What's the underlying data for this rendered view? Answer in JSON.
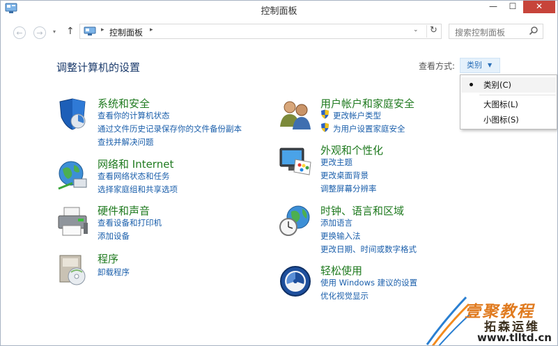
{
  "window": {
    "title": "控制面板",
    "minimize_glyph": "—",
    "maximize_glyph": "☐",
    "close_glyph": "✕"
  },
  "nav": {
    "back_glyph": "←",
    "forward_glyph": "→",
    "recent_glyph": "▾",
    "up_glyph": "↑",
    "breadcrumb_root_arrow": "▸",
    "breadcrumb": "控制面板",
    "breadcrumb_after_arrow": "▸",
    "dropdown_glyph": "⌄",
    "refresh_glyph": "↻",
    "search_placeholder": "搜索控制面板"
  },
  "main": {
    "heading": "调整计算机的设置",
    "viewby_label": "查看方式:",
    "viewby_value": "类别",
    "viewby_caret": "▼"
  },
  "categories_left": [
    {
      "title": "系统和安全",
      "icon": "shield-icon",
      "links": [
        "查看你的计算机状态",
        "通过文件历史记录保存你的文件备份副本",
        "查找并解决问题"
      ]
    },
    {
      "title": "网络和 Internet",
      "icon": "globe-network-icon",
      "links": [
        "查看网络状态和任务",
        "选择家庭组和共享选项"
      ]
    },
    {
      "title": "硬件和声音",
      "icon": "printer-icon",
      "links": [
        "查看设备和打印机",
        "添加设备"
      ]
    },
    {
      "title": "程序",
      "icon": "programs-box-icon",
      "links": [
        "卸载程序"
      ]
    }
  ],
  "categories_right": [
    {
      "title": "用户帐户和家庭安全",
      "icon": "users-icon",
      "links": [
        "更改帐户类型",
        "为用户设置家庭安全"
      ]
    },
    {
      "title": "外观和个性化",
      "icon": "monitor-palette-icon",
      "links": [
        "更改主题",
        "更改桌面背景",
        "调整屏幕分辨率"
      ]
    },
    {
      "title": "时钟、语言和区域",
      "icon": "globe-clock-icon",
      "links": [
        "添加语言",
        "更换输入法",
        "更改日期、时间或数字格式"
      ]
    },
    {
      "title": "轻松使用",
      "icon": "ease-of-access-icon",
      "links": [
        "使用 Windows 建议的设置",
        "优化视觉显示"
      ]
    }
  ],
  "dropdown": {
    "items": [
      "类别(C)",
      "大图标(L)",
      "小图标(S)"
    ],
    "selected": "类别(C)"
  },
  "watermark": {
    "line1": "壹聚教程",
    "line2": "拓森运维",
    "url": "www.tlltd.cn"
  },
  "colors": {
    "category_title": "#1f7a1f",
    "link": "#1b5fab",
    "heading": "#1a3a6b",
    "close_button": "#c7443a",
    "viewby_bg": "#e5f1fb"
  }
}
